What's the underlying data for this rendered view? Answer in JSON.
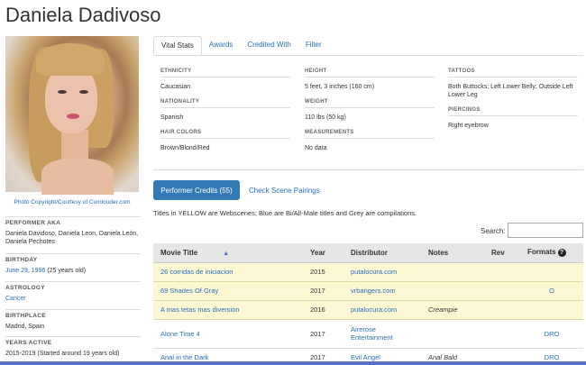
{
  "page": {
    "title": "Daniela Dadivoso"
  },
  "photo": {
    "credit": "Photo Copyright/Courtesy of Cumlouder.com"
  },
  "sidebar": {
    "aka_label": "PERFORMER AKA",
    "aka_value": "Daniela Davidoso, Daniela Leon, Daniela León, Daniela Pechotes",
    "birthday_label": "BIRTHDAY",
    "birthday_link": "June 29, 1996",
    "birthday_age": "(25 years old)",
    "astrology_label": "ASTROLOGY",
    "astrology_value": "Cancer",
    "birthplace_label": "BIRTHPLACE",
    "birthplace_value": "Madrid, Spain",
    "years_label": "YEARS ACTIVE",
    "years_value": "2015-2019 (Started around 19 years old)"
  },
  "tabs": [
    "Vital Stats",
    "Awards",
    "Credited With",
    "Filter"
  ],
  "stats": {
    "ethnicity_label": "ETHNICITY",
    "ethnicity": "Caucasian",
    "nationality_label": "NATIONALITY",
    "nationality": "Spanish",
    "hair_label": "HAIR COLORS",
    "hair": "Brown/Blond/Red",
    "height_label": "HEIGHT",
    "height": "5 feet, 3 inches (160 cm)",
    "weight_label": "WEIGHT",
    "weight": "110 lbs (50 kg)",
    "measurements_label": "MEASUREMENTS",
    "measurements": "No data",
    "tattoos_label": "TATTOOS",
    "tattoos": "Both Buttocks; Left Lower Belly; Outside Left Lower Leg",
    "piercings_label": "PIERCINGS",
    "piercings": "Right eyebrow"
  },
  "credits": {
    "button": "Performer Credits (55)",
    "pairings": "Check Scene Pairings",
    "note": "Titles in YELLOW are Webscenes; Blue are Bi/All-Male titles and Grey are compilations.",
    "search_label": "Search:",
    "columns": {
      "title": "Movie Title",
      "year": "Year",
      "distributor": "Distributor",
      "notes": "Notes",
      "rev": "Rev",
      "formats": "Formats"
    },
    "sort_arrow": "▲",
    "help_icon": "?",
    "rows": [
      {
        "title": "26 corridas de iniciacion",
        "year": "2015",
        "distributor": "putalocura.com",
        "notes": "",
        "rev": "",
        "formats": ""
      },
      {
        "title": "69 Shades Of Gray",
        "year": "2017",
        "distributor": "vrbangers.com",
        "notes": "",
        "rev": "",
        "formats": "O"
      },
      {
        "title": "A mas tetas mas diversion",
        "year": "2016",
        "distributor": "putalocura.com",
        "notes": "Creampie",
        "rev": "",
        "formats": ""
      },
      {
        "title": "Alone Time 4",
        "year": "2017",
        "distributor": "Airerose Entertainment",
        "notes": "",
        "rev": "",
        "formats": "DRO"
      },
      {
        "title": "Anal in the Dark",
        "year": "2017",
        "distributor": "Evil Angel",
        "notes": "Anal Bald",
        "rev": "",
        "formats": "DRO"
      }
    ]
  }
}
